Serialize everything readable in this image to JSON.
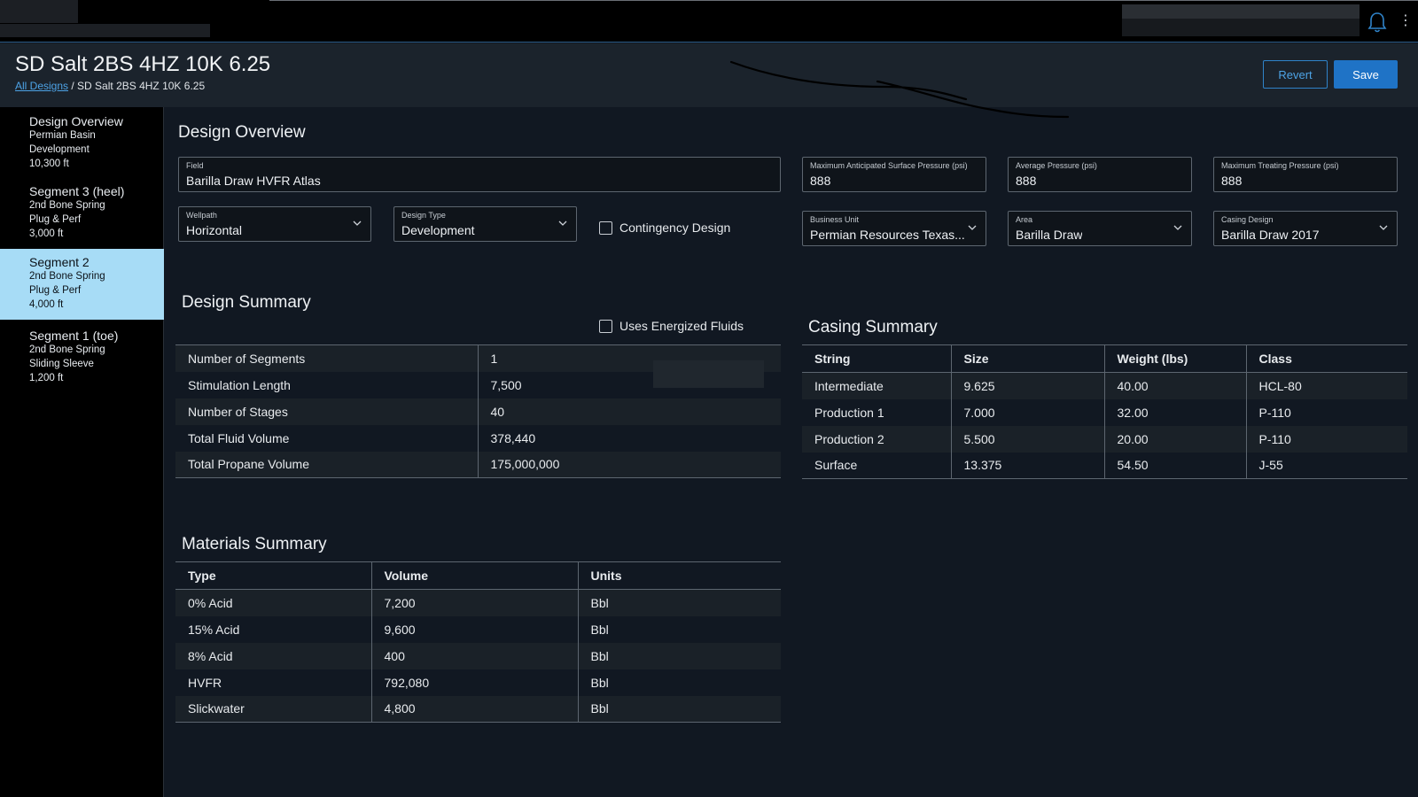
{
  "header": {
    "title": "SD Salt 2BS 4HZ 10K 6.25",
    "breadcrumb_link": "All Designs",
    "breadcrumb_separator": " / ",
    "breadcrumb_current": "SD Salt 2BS 4HZ 10K 6.25",
    "revert_label": "Revert",
    "save_label": "Save"
  },
  "sidebar": {
    "items": [
      {
        "title": "Design Overview",
        "lines": [
          "Permian Basin",
          "Development",
          "10,300 ft"
        ],
        "active": false
      },
      {
        "title": "Segment 3 (heel)",
        "lines": [
          "2nd Bone Spring",
          "Plug & Perf",
          "3,000 ft"
        ],
        "active": false
      },
      {
        "title": "Segment 2",
        "lines": [
          "2nd Bone Spring",
          "Plug & Perf",
          "4,000 ft"
        ],
        "active": true
      },
      {
        "title": "Segment 1 (toe)",
        "lines": [
          "2nd Bone Spring",
          "Sliding Sleeve",
          "1,200 ft"
        ],
        "active": false
      }
    ]
  },
  "overview": {
    "title": "Design Overview",
    "field": {
      "label": "Field",
      "value": "Barilla Draw HVFR Atlas"
    },
    "wellpath": {
      "label": "Wellpath",
      "value": "Horizontal"
    },
    "design_type": {
      "label": "Design Type",
      "value": "Development"
    },
    "contingency_label": "Contingency Design",
    "max_surface_pressure": {
      "label": "Maximum Anticipated Surface Pressure (psi)",
      "value": "888"
    },
    "avg_pressure": {
      "label": "Average Pressure (psi)",
      "value": "888"
    },
    "max_treating_pressure": {
      "label": "Maximum Treating Pressure (psi)",
      "value": "888"
    },
    "business_unit": {
      "label": "Business Unit",
      "value": "Permian Resources Texas..."
    },
    "area": {
      "label": "Area",
      "value": "Barilla Draw"
    },
    "casing_design": {
      "label": "Casing Design",
      "value": "Barilla Draw 2017"
    }
  },
  "design_summary": {
    "title": "Design Summary",
    "energized_label": "Uses Energized Fluids",
    "rows": [
      [
        "Number of Segments",
        "1"
      ],
      [
        "Stimulation Length",
        "7,500"
      ],
      [
        "Number of Stages",
        "40"
      ],
      [
        "Total Fluid Volume",
        "378,440"
      ],
      [
        "Total Propane Volume",
        "175,000,000"
      ]
    ]
  },
  "casing_summary": {
    "title": "Casing Summary",
    "headers": [
      "String",
      "Size",
      "Weight (lbs)",
      "Class"
    ],
    "rows": [
      [
        "Intermediate",
        "9.625",
        "40.00",
        "HCL-80"
      ],
      [
        "Production 1",
        "7.000",
        "32.00",
        "P-110"
      ],
      [
        "Production 2",
        "5.500",
        "20.00",
        "P-110"
      ],
      [
        "Surface",
        "13.375",
        "54.50",
        "J-55"
      ]
    ]
  },
  "materials_summary": {
    "title": "Materials Summary",
    "headers": [
      "Type",
      "Volume",
      "Units"
    ],
    "rows": [
      [
        "0% Acid",
        "7,200",
        "Bbl"
      ],
      [
        "15% Acid",
        "9,600",
        "Bbl"
      ],
      [
        "8% Acid",
        "400",
        "Bbl"
      ],
      [
        "HVFR",
        "792,080",
        "Bbl"
      ],
      [
        "Slickwater",
        "4,800",
        "Bbl"
      ]
    ]
  },
  "icons": {
    "bell": "bell-icon",
    "kebab": "kebab-menu-icon",
    "chevron": "chevron-down-icon"
  },
  "colors": {
    "accent": "#1f73c6",
    "active_item": "#a7dcf6",
    "link": "#4da3e6"
  }
}
